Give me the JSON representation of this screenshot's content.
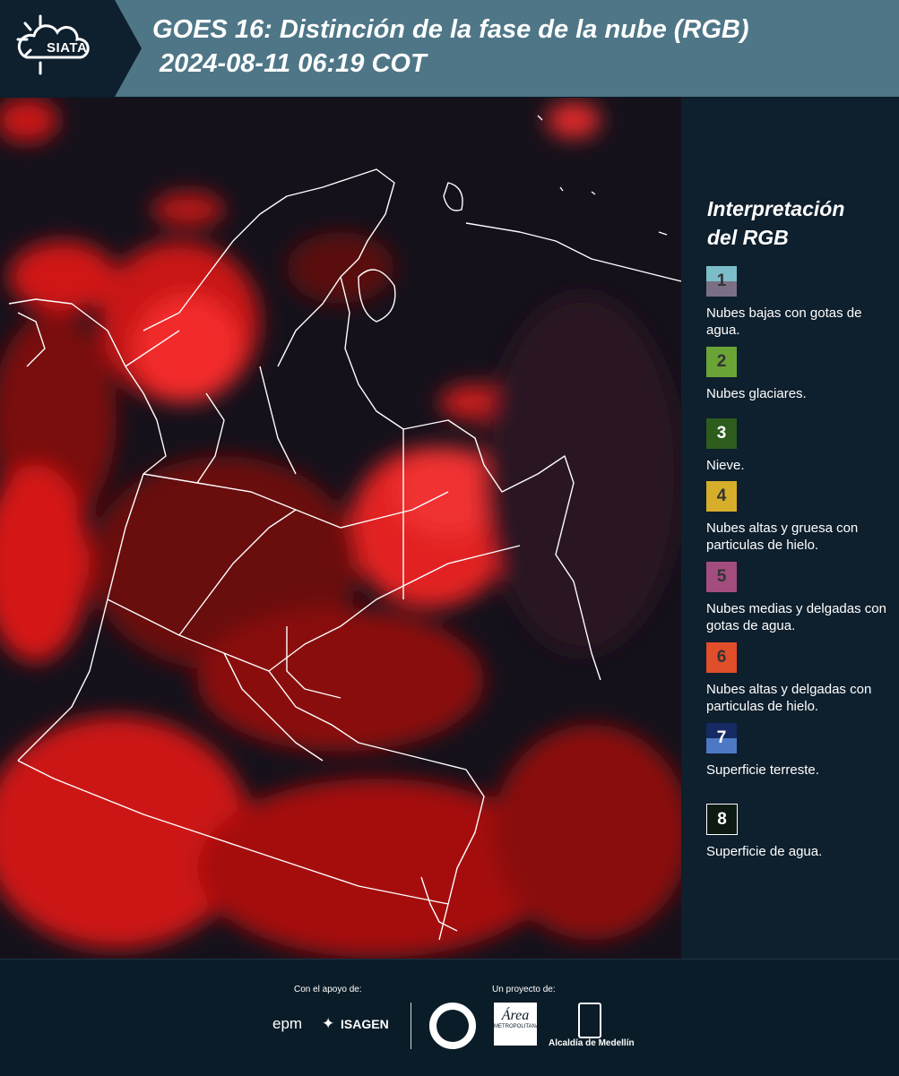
{
  "header": {
    "logo_text": "SIATA",
    "title_line1": "GOES 16: Distinción de la fase de la nube (RGB)",
    "title_line2": "2024-08-11 06:19 COT",
    "bg_color": "#4e7687",
    "tab_color": "#0e1f2d"
  },
  "legend": {
    "title_line1": "Interpretación",
    "title_line2": "del RGB",
    "items": [
      {
        "num": "1",
        "label": "Nubes bajas con gotas de agua.",
        "color_top": "#7bbec9",
        "color_bottom": "#7b6f86"
      },
      {
        "num": "2",
        "label": "Nubes glaciares.",
        "color_top": "#6aa437",
        "color_bottom": "#6aa437"
      },
      {
        "num": "3",
        "label": "Nieve.",
        "color_top": "#2d5c1d",
        "color_bottom": "#2d5c1d"
      },
      {
        "num": "4",
        "label": "Nubes altas y gruesa con particulas de hielo.",
        "color_top": "#d6ae2a",
        "color_bottom": "#d6ae2a"
      },
      {
        "num": "5",
        "label": "Nubes medias y delgadas con gotas de agua.",
        "color_top": "#a24d7e",
        "color_bottom": "#a24d7e"
      },
      {
        "num": "6",
        "label": "Nubes altas y delgadas con particulas de hielo.",
        "color_top": "#e04e2b",
        "color_bottom": "#e04e2b"
      },
      {
        "num": "7",
        "label": "Superficie terreste.",
        "color_top": "#152a63",
        "color_bottom": "#4d79c4"
      },
      {
        "num": "8",
        "label": "Superficie de agua.",
        "color_top": "#0d1a12",
        "color_bottom": "#0d1a12"
      }
    ]
  },
  "footer": {
    "support_label": "Con el apoyo de:",
    "project_label": "Un proyecto de:",
    "sponsor_epm": "epm",
    "sponsor_isagen": "ISAGEN",
    "area_logo_text": "Área",
    "area_logo_sub": "METROPOLITANA",
    "alcaldia_text": "Alcaldía de Medellín"
  },
  "map": {
    "cloud_color": "#e81010",
    "background_color": "#14101a",
    "border_color": "#ffffff"
  }
}
